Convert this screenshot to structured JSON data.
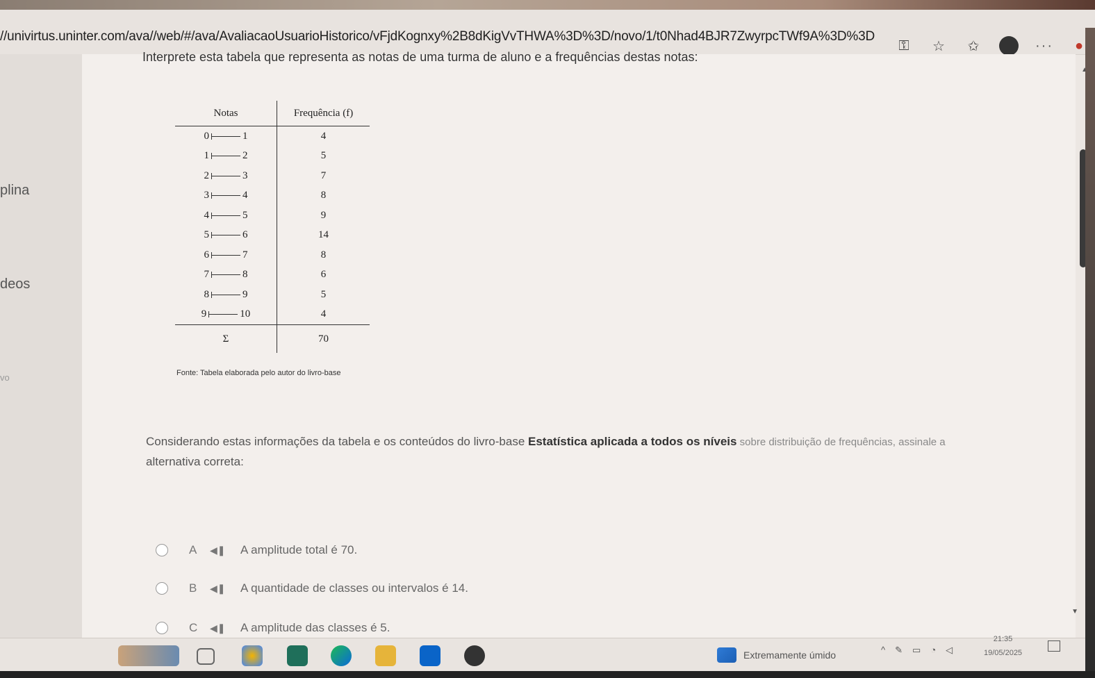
{
  "browser": {
    "url": "//univirtus.uninter.com/ava//web/#/ava/AvaliacaoUsuarioHistorico/vFjdKognxy%2B8dKigVvTHWA%3D%3D/novo/1/t0Nhad4BJR7ZwyrpcTWf9A%3D%3D"
  },
  "sidebar": {
    "items": [
      {
        "label": "plina"
      },
      {
        "label": "deos"
      },
      {
        "label": "vo"
      }
    ]
  },
  "question": {
    "text": "Interprete esta tabela que representa as notas de uma turma de aluno e a frequências destas notas:"
  },
  "table": {
    "headers": {
      "notas": "Notas",
      "freq": "Frequência (f)"
    },
    "rows": [
      {
        "from": "0",
        "to": "1",
        "f": "4"
      },
      {
        "from": "1",
        "to": "2",
        "f": "5"
      },
      {
        "from": "2",
        "to": "3",
        "f": "7"
      },
      {
        "from": "3",
        "to": "4",
        "f": "8"
      },
      {
        "from": "4",
        "to": "5",
        "f": "9"
      },
      {
        "from": "5",
        "to": "6",
        "f": "14"
      },
      {
        "from": "6",
        "to": "7",
        "f": "8"
      },
      {
        "from": "7",
        "to": "8",
        "f": "6"
      },
      {
        "from": "8",
        "to": "9",
        "f": "5"
      },
      {
        "from": "9",
        "to": "10",
        "f": "4"
      }
    ],
    "sum_symbol": "Σ",
    "sum_value": "70",
    "source": "Fonte: Tabela elaborada pelo autor do livro-base"
  },
  "prompt": {
    "part1": "Considerando estas informações da tabela e os conteúdos do livro-base ",
    "bold": "Estatística aplicada a todos os níveis",
    "part2": " sobre distribuição de frequências, assinale a",
    "part3": "alternativa correta:"
  },
  "options": [
    {
      "letter": "A",
      "text": "A amplitude total é 70."
    },
    {
      "letter": "B",
      "text": "A quantidade de classes ou intervalos é 14."
    },
    {
      "letter": "C",
      "text": "A amplitude das classes é 5."
    }
  ],
  "taskbar": {
    "weather": "Extremamente úmido",
    "time": "21:35",
    "date": "19/05/2025"
  }
}
